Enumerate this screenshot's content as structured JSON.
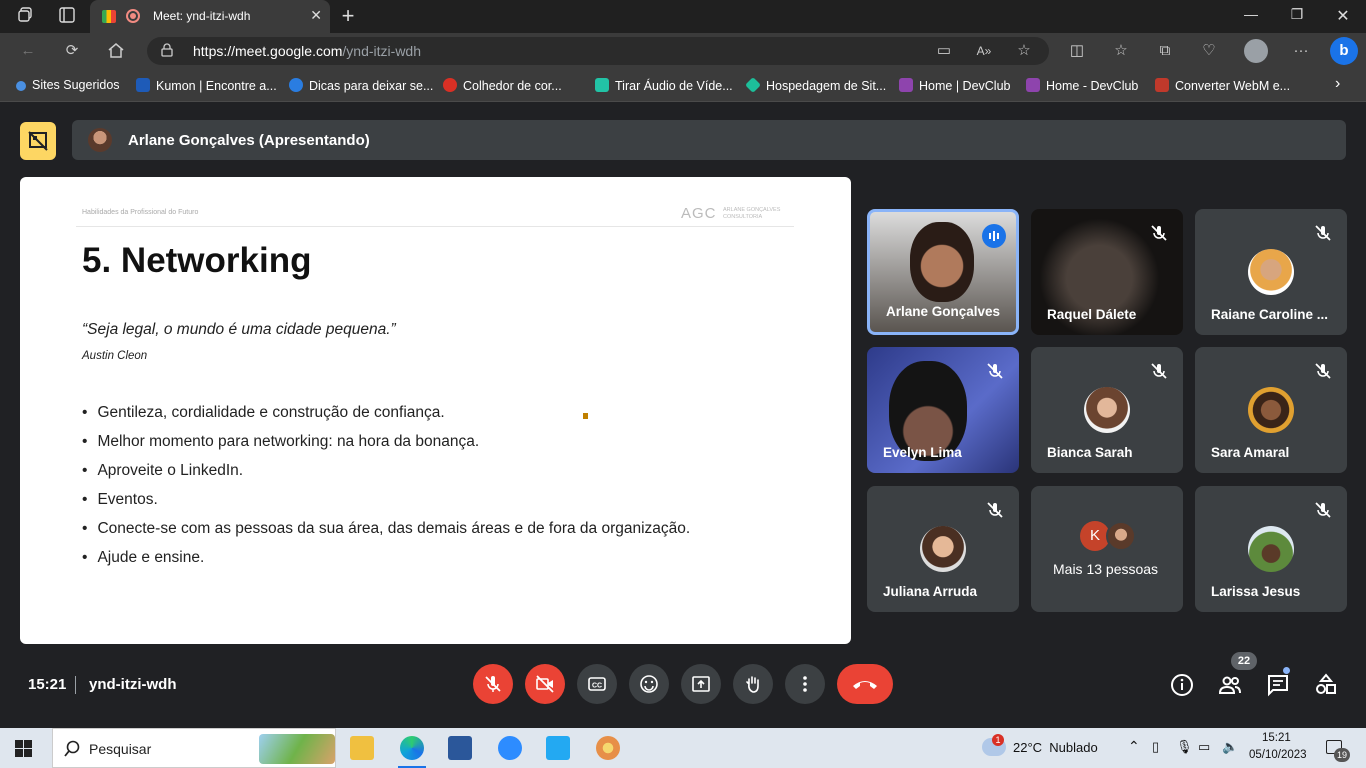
{
  "browser": {
    "tab_title": "Meet: ynd-itzi-wdh",
    "url_host": "https://meet.google.com",
    "url_path": "/ynd-itzi-wdh",
    "bookmarks": [
      {
        "label": "Sites Sugeridos",
        "color": "#4a90e2"
      },
      {
        "label": "Kumon | Encontre a...",
        "color": "#1e5bb8"
      },
      {
        "label": "Dicas para deixar se...",
        "color": "#2a7de1"
      },
      {
        "label": "Colhedor de cor...",
        "color": "#d93025"
      },
      {
        "label": "Tirar Áudio de Víde...",
        "color": "#22c3a6"
      },
      {
        "label": "Hospedagem de Sit...",
        "color": "#1dbf9a"
      },
      {
        "label": "Home | DevClub",
        "color": "#8e44ad"
      },
      {
        "label": "Home - DevClub",
        "color": "#8e44ad"
      },
      {
        "label": "Converter WebM e...",
        "color": "#c0392b"
      }
    ]
  },
  "meet": {
    "presenter_label": "Arlane Gonçalves (Apresentando)",
    "time": "15:21",
    "meeting_code": "ynd-itzi-wdh",
    "people_count": "22",
    "accent_red": "#ea4335"
  },
  "slide": {
    "header_left": "Habilidades da Profissional do Futuro",
    "brand_mark": "AGC",
    "brand_name": "ARLANE GONÇALVES",
    "brand_sub": "CONSULTORIA",
    "title": "5. Networking",
    "quote": "“Seja legal, o mundo é uma cidade pequena.”",
    "author": "Austin Cleon",
    "bullets": [
      "Gentileza, cordialidade e construção de confiança.",
      "Melhor momento para networking: na hora da bonança.",
      "Aproveite o LinkedIn.",
      "Eventos.",
      "Conecte-se com as pessoas da sua área, das demais áreas e de fora da organização.",
      "Ajude e ensine."
    ]
  },
  "participants": [
    {
      "name": "Arlane Gonçalves"
    },
    {
      "name": "Raquel Dálete"
    },
    {
      "name": "Raiane Caroline ..."
    },
    {
      "name": "Evelyn Lima"
    },
    {
      "name": "Bianca Sarah"
    },
    {
      "name": "Sara Amaral"
    },
    {
      "name": "Juliana Arruda"
    },
    {
      "name": "Mais 13 pessoas",
      "avatar_letter": "K"
    },
    {
      "name": "Larissa Jesus"
    }
  ],
  "taskbar": {
    "search_placeholder": "Pesquisar",
    "weather": "22°C  Nublado",
    "weather_badge": "1",
    "clock_time": "15:21",
    "clock_date": "05/10/2023",
    "notif_count": "19"
  }
}
